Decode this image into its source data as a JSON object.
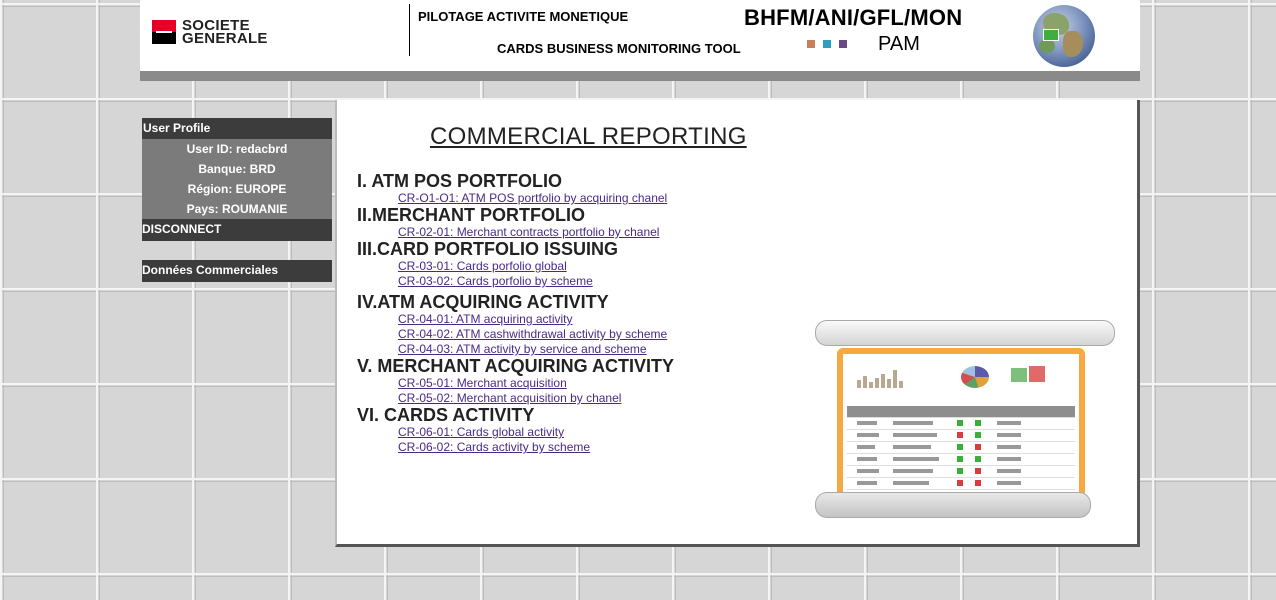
{
  "header": {
    "logo_text_line1": "SOCIETE",
    "logo_text_line2": "GENERALE",
    "title1": "PILOTAGE ACTIVITE MONETIQUE",
    "title2": "CARDS BUSINESS MONITORING TOOL",
    "app_code": "BHFM/ANI/GFL/MON",
    "app_sub": "PAM",
    "colors": {
      "logo_red": "#e60028",
      "sq1": "#c8805a",
      "sq2": "#2e9ec0",
      "sq3": "#6a4a84"
    }
  },
  "sidebar": {
    "profile_title": "User Profile",
    "user_id": "User ID: redacbrd",
    "bank": "Banque: BRD",
    "region": "Région: EUROPE",
    "country": "Pays: ROUMANIE",
    "disconnect": "DISCONNECT",
    "commercial_data": "Données Commerciales"
  },
  "main": {
    "title": "COMMERCIAL REPORTING",
    "sections": [
      {
        "title": "I. ATM POS PORTFOLIO",
        "links": [
          "CR-O1-O1: ATM POS portfolio by acquiring chanel"
        ]
      },
      {
        "title": "II.MERCHANT PORTFOLIO",
        "links": [
          "CR-02-01: Merchant contracts portfolio by chanel"
        ]
      },
      {
        "title": "III.CARD PORTFOLIO ISSUING",
        "links": [
          "CR-03-01: Cards porfolio global",
          "CR-03-02: Cards porfolio by scheme"
        ]
      },
      {
        "title": "IV.ATM ACQUIRING ACTIVITY",
        "links": [
          "CR-04-01: ATM acquiring activity",
          "CR-04-02: ATM cashwithdrawal activity by scheme",
          "CR-04-03: ATM activity by service and scheme"
        ]
      },
      {
        "title": "V. MERCHANT ACQUIRING ACTIVITY",
        "links": [
          "CR-05-01: Merchant acquisition",
          "CR-05-02: Merchant acquisition by chanel"
        ]
      },
      {
        "title": "VI. CARDS ACTIVITY",
        "links": [
          "CR-06-01: Cards global activity",
          "CR-06-02: Cards activity by scheme"
        ]
      }
    ]
  }
}
